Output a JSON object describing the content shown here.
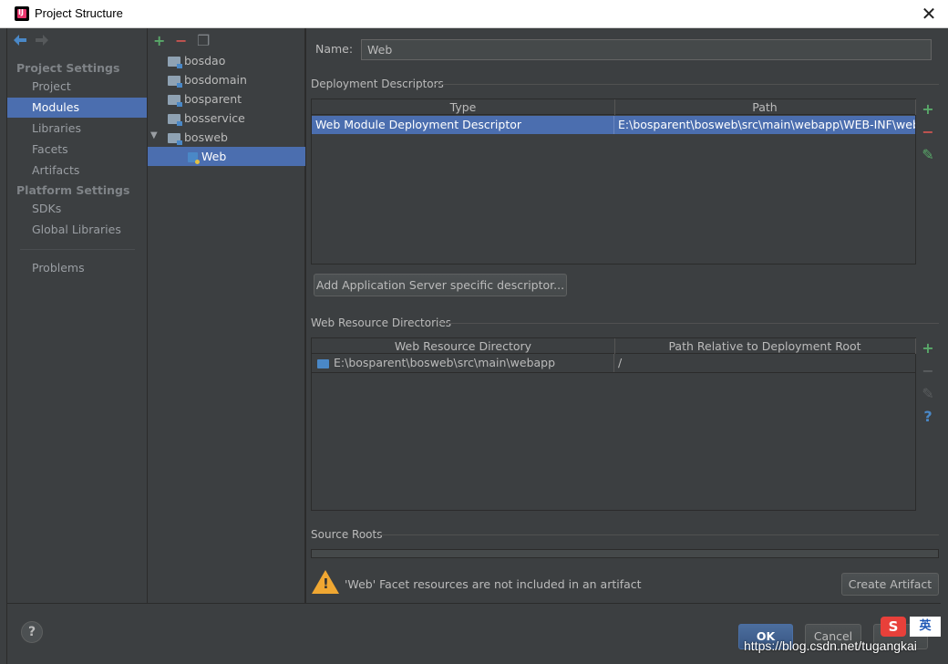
{
  "window": {
    "title": "Project Structure",
    "close_glyph": "✕"
  },
  "sidebar": {
    "back_glyph": "◆",
    "forward_glyph": "◆",
    "sections": [
      {
        "title": "Project Settings",
        "items": [
          "Project",
          "Modules",
          "Libraries",
          "Facets",
          "Artifacts"
        ]
      },
      {
        "title": "Platform Settings",
        "items": [
          "SDKs",
          "Global Libraries"
        ]
      }
    ],
    "selected": "Modules",
    "extra_item": "Problems"
  },
  "tree": {
    "add_glyph": "+",
    "remove_glyph": "−",
    "copy_glyph": "❐",
    "expand_glyph": "▼",
    "items": [
      "bosdao",
      "bosdomain",
      "bosparent",
      "bosservice",
      "bosweb"
    ],
    "child": "Web"
  },
  "main": {
    "name_label": "Name:",
    "name_value": "Web",
    "deployment": {
      "title": "Deployment Descriptors",
      "columns": [
        "Type",
        "Path"
      ],
      "rows": [
        [
          "Web Module Deployment Descriptor",
          "E:\\bosparent\\bosweb\\src\\main\\webapp\\WEB-INF\\web.xml"
        ]
      ],
      "add_server_button": "Add Application Server specific descriptor..."
    },
    "resources": {
      "title": "Web Resource Directories",
      "columns": [
        "Web Resource Directory",
        "Path Relative to Deployment Root"
      ],
      "rows": [
        [
          "E:\\bosparent\\bosweb\\src\\main\\webapp",
          "/"
        ]
      ]
    },
    "source_roots": {
      "title": "Source Roots"
    },
    "side_add": "+",
    "side_remove": "−",
    "side_edit": "✎",
    "side_help": "?"
  },
  "warning": {
    "text": "'Web' Facet resources are not included in an artifact",
    "button": "Create Artifact"
  },
  "footer": {
    "help": "?",
    "ok": "OK",
    "cancel": "Cancel",
    "watermark": "https://blog.csdn.net/tugangkai",
    "ime_text": "英"
  },
  "colors": {
    "accent": "#4b6eaf",
    "panel": "#3c3f41",
    "add_green": "#59a869",
    "remove_red": "#c75450",
    "warning": "#f0a732"
  }
}
